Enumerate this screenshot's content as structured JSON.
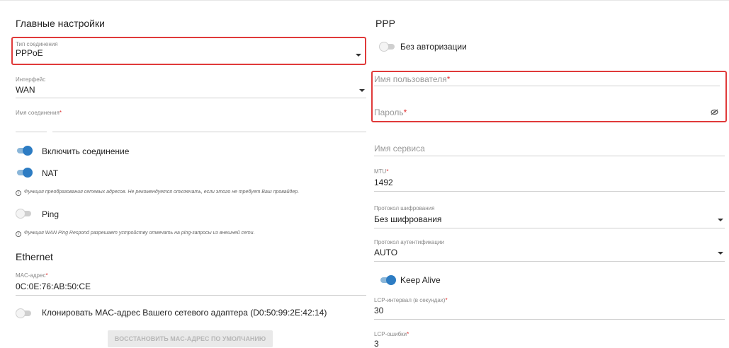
{
  "left": {
    "main_title": "Главные настройки",
    "connection_type": {
      "label": "Тип соединения",
      "value": "PPPoE"
    },
    "interface": {
      "label": "Интерфейс",
      "value": "WAN"
    },
    "connection_name": {
      "label": "Имя соединения",
      "required": "*",
      "value": ""
    },
    "enable_connection": {
      "label": "Включить соединение",
      "on": true
    },
    "nat": {
      "label": "NAT",
      "on": true,
      "info": "Функция преобразования сетевых адресов. Не рекомендуется отключать, если этого не требует Ваш провайдер."
    },
    "ping": {
      "label": "Ping",
      "on": false,
      "info": "Функция WAN Ping Respond разрешает устройству отвечать на ping-запросы из внешней сети."
    },
    "ethernet_title": "Ethernet",
    "mac": {
      "label": "MAC-адрес",
      "required": "*",
      "value": "0C:0E:76:AB:50:CE"
    },
    "clone_mac": {
      "label": "Клонировать MAC-адрес Вашего сетевого адаптера (D0:50:99:2E:42:14)",
      "on": false
    },
    "restore_button": "ВОССТАНОВИТЬ MAC-АДРЕС ПО УМОЛЧАНИЮ"
  },
  "right": {
    "ppp_title": "PPP",
    "no_auth": {
      "label": "Без авторизации",
      "on": false
    },
    "username": {
      "placeholder": "Имя пользователя",
      "required": "*"
    },
    "password": {
      "placeholder": "Пароль",
      "required": "*"
    },
    "service_name": {
      "placeholder": "Имя сервиса"
    },
    "mtu": {
      "label": "MTU",
      "required": "*",
      "value": "1492"
    },
    "encryption": {
      "label": "Протокол шифрования",
      "value": "Без шифрования"
    },
    "auth_protocol": {
      "label": "Протокол аутентификации",
      "value": "AUTO"
    },
    "keep_alive": {
      "label": "Keep Alive",
      "on": true
    },
    "lcp_interval": {
      "label": "LCP-интервал (в секундах)",
      "required": "*",
      "value": "30"
    },
    "lcp_errors": {
      "label": "LCP-ошибки",
      "required": "*",
      "value": "3"
    }
  },
  "colors": {
    "accent": "#2d7cc3",
    "highlight": "#e03a3a",
    "required": "#e03030"
  },
  "icons": {
    "caret": "chevron-down-icon",
    "eye": "eye-off-icon",
    "info": "info-icon"
  }
}
